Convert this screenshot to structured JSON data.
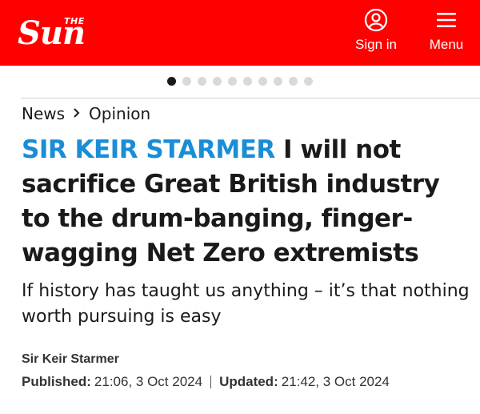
{
  "header": {
    "logo_small": "THE",
    "logo_main": "Sun",
    "signin_label": "Sign in",
    "menu_label": "Menu",
    "brand_color": "#ff0000"
  },
  "carousel": {
    "total": 10,
    "active_index": 0
  },
  "breadcrumb": {
    "section": "News",
    "subsection": "Opinion",
    "separator_icon": "chevron-right-icon"
  },
  "article": {
    "kicker": "SIR KEIR STARMER",
    "headline": "I will not sacrifice Great British industry to the drum-banging, finger-wagging Net Zero extremists",
    "kicker_color": "#1a8dd6",
    "standfirst": "If history has taught us anything – it’s that nothing worth pursuing is easy",
    "author": "Sir Keir Starmer",
    "published_label": "Published:",
    "published_value": "21:06, 3 Oct 2024",
    "updated_label": "Updated:",
    "updated_value": "21:42, 3 Oct 2024"
  }
}
